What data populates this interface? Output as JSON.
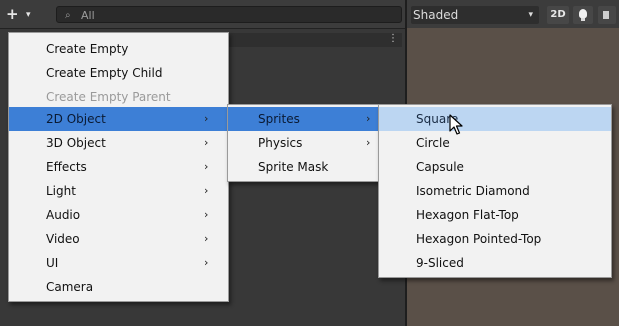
{
  "hierarchy_toolbar": {
    "add_button_label": "+",
    "add_dropdown_glyph": "▾",
    "search_icon": "search-icon",
    "search_value": "All"
  },
  "scene_toolbar": {
    "shading_mode": "Shaded",
    "dropdown_glyph": "▾",
    "mode_2d_label": "2D",
    "light_icon": "lightbulb-icon",
    "audio_icon": "speaker-icon"
  },
  "hierarchy_panel": {
    "menu_dots": "⋮"
  },
  "create_menu": {
    "items": [
      {
        "label": "Create Empty",
        "submenu": false
      },
      {
        "label": "Create Empty Child",
        "submenu": false
      },
      {
        "label": "Create Empty Parent",
        "submenu": false
      },
      {
        "label": "2D Object",
        "submenu": true,
        "chevron": "›"
      },
      {
        "label": "3D Object",
        "submenu": true,
        "chevron": "›"
      },
      {
        "label": "Effects",
        "submenu": true,
        "chevron": "›"
      },
      {
        "label": "Light",
        "submenu": true,
        "chevron": "›"
      },
      {
        "label": "Audio",
        "submenu": true,
        "chevron": "›"
      },
      {
        "label": "Video",
        "submenu": true,
        "chevron": "›"
      },
      {
        "label": "UI",
        "submenu": true,
        "chevron": "›"
      },
      {
        "label": "Camera",
        "submenu": false
      }
    ],
    "highlighted": "2D Object"
  },
  "object2d_menu": {
    "items": [
      {
        "label": "Sprites",
        "submenu": true,
        "chevron": "›"
      },
      {
        "label": "Physics",
        "submenu": true,
        "chevron": "›"
      },
      {
        "label": "Sprite Mask",
        "submenu": false
      }
    ],
    "highlighted": "Sprites"
  },
  "sprites_menu": {
    "items": [
      {
        "label": "Square"
      },
      {
        "label": "Circle"
      },
      {
        "label": "Capsule"
      },
      {
        "label": "Isometric Diamond"
      },
      {
        "label": "Hexagon Flat-Top"
      },
      {
        "label": "Hexagon Pointed-Top"
      },
      {
        "label": "9-Sliced"
      }
    ],
    "highlighted": "Square"
  },
  "colors": {
    "menu_highlight": "#3d7fd6",
    "sprites_hover": "#bcd6f2",
    "menu_background": "#f2f2f2",
    "editor_dark": "#383838"
  }
}
